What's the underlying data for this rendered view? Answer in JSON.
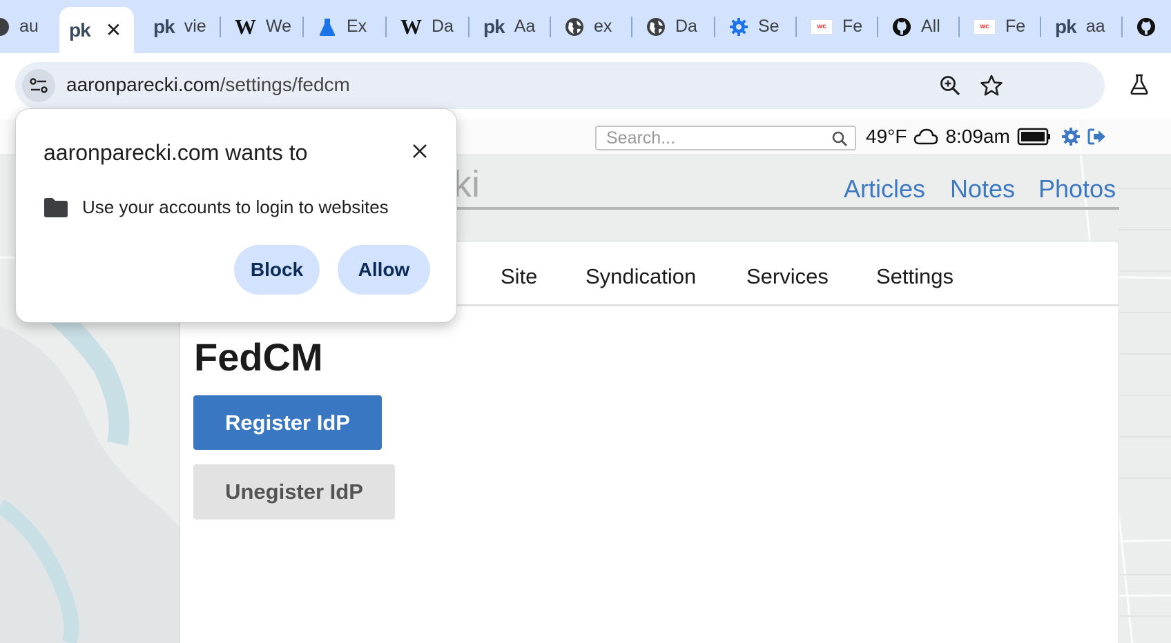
{
  "browser": {
    "tabs": [
      {
        "title": "au",
        "icon": "half-circle-icon"
      },
      {
        "title": "",
        "icon": "pk-logo-icon",
        "active": true
      },
      {
        "title": "vie",
        "icon": "pk-logo-icon"
      },
      {
        "title": "We",
        "icon": "wikipedia-w-icon"
      },
      {
        "title": "Ex",
        "icon": "flask-icon"
      },
      {
        "title": "Da",
        "icon": "wikipedia-w-icon"
      },
      {
        "title": "Aa",
        "icon": "pk-logo-icon"
      },
      {
        "title": "ex",
        "icon": "globe-icon"
      },
      {
        "title": "Da",
        "icon": "globe-icon"
      },
      {
        "title": "Se",
        "icon": "gear-icon"
      },
      {
        "title": "Fe",
        "icon": "wc-logo-icon"
      },
      {
        "title": "All",
        "icon": "github-icon"
      },
      {
        "title": "Fe",
        "icon": "wc-logo-icon"
      },
      {
        "title": "aa",
        "icon": "pk-logo-icon"
      },
      {
        "title": "",
        "icon": "github-icon"
      }
    ],
    "favicon_text": {
      "pk": "pk",
      "w": "W",
      "wc": "wc"
    },
    "close_glyph": "✕",
    "url_domain": "aaronparecki.com",
    "url_path": "/settings/fedcm",
    "colors": {
      "tabstrip": "#d3e3fd",
      "omnibox": "#e9eef6",
      "accent_blue": "#1a73e8"
    }
  },
  "permission_popup": {
    "title": "aaronparecki.com wants to",
    "description": "Use your accounts to login to websites",
    "block_label": "Block",
    "allow_label": "Allow",
    "close_glyph": "✕"
  },
  "page": {
    "search_placeholder": "Search...",
    "temperature": "49°F",
    "time": "8:09am",
    "site_title_fragment": "ki",
    "nav": {
      "articles": "Articles",
      "notes": "Notes",
      "photos": "Photos"
    },
    "subnav": {
      "site": "Site",
      "syndication": "Syndication",
      "services": "Services",
      "settings": "Settings"
    },
    "heading": "FedCM",
    "register_label": "Register IdP",
    "unregister_label": "Unegister IdP",
    "colors": {
      "link_blue": "#3d78c2",
      "primary_button": "#3a77c2",
      "secondary_button": "#e2e2e2"
    }
  }
}
